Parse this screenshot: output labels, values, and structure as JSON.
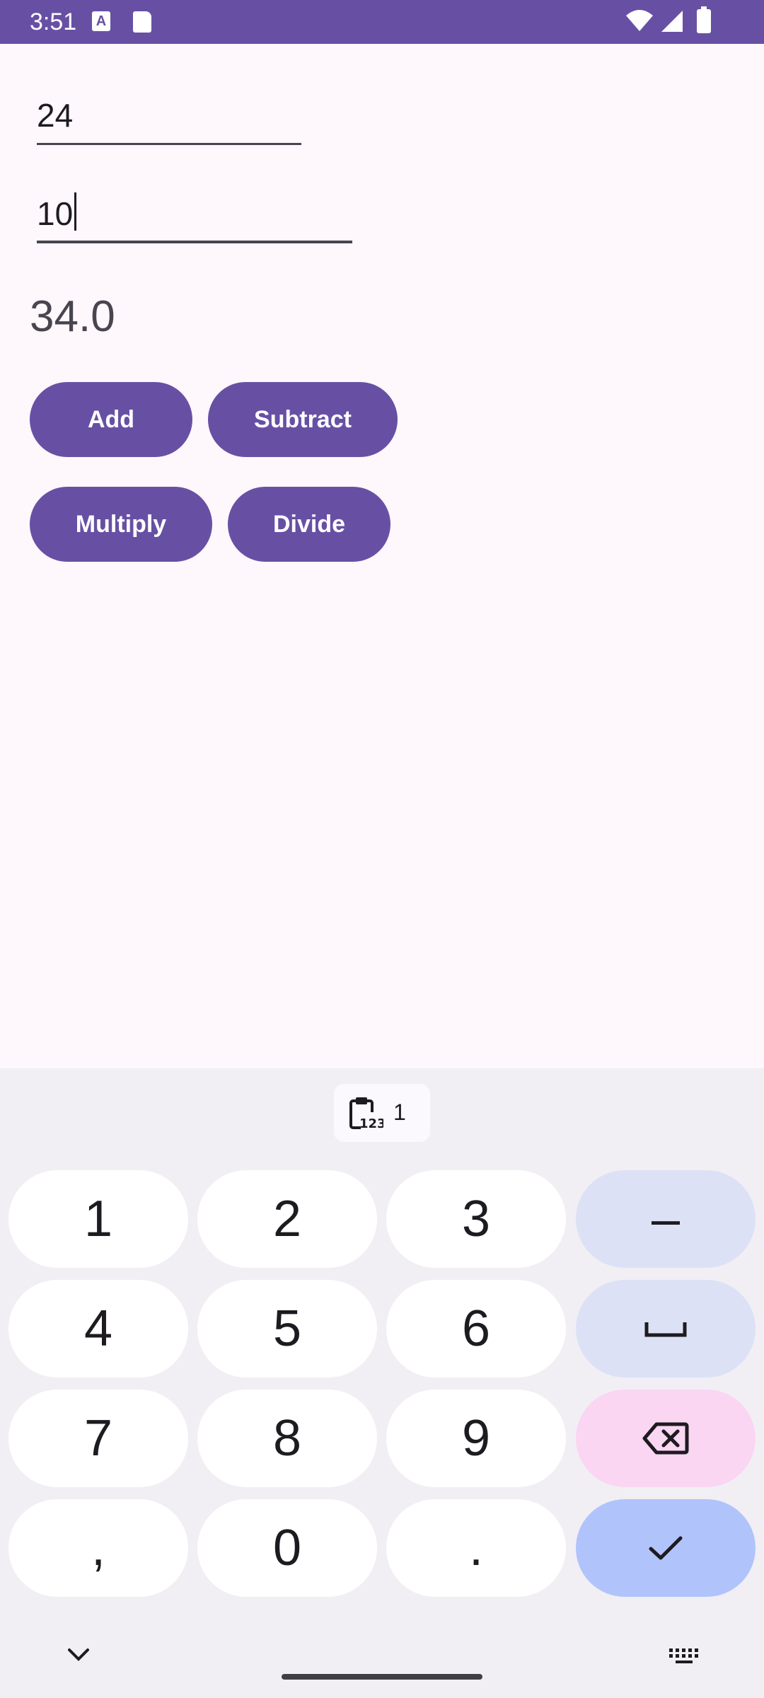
{
  "status_bar": {
    "time": "3:51",
    "icons": [
      "app-notification-icon",
      "sd-card-icon",
      "wifi-icon",
      "signal-icon",
      "battery-icon"
    ],
    "a_glyph": "A"
  },
  "form": {
    "first_number": "24",
    "second_number": "10",
    "result": "34.0"
  },
  "buttons": {
    "add": "Add",
    "subtract": "Subtract",
    "multiply": "Multiply",
    "divide": "Divide"
  },
  "keyboard": {
    "clipboard_count": "1",
    "keys": {
      "k1": "1",
      "k2": "2",
      "k3": "3",
      "minus": "–",
      "k4": "4",
      "k5": "5",
      "k6": "6",
      "k7": "7",
      "k8": "8",
      "k9": "9",
      "comma": ",",
      "k0": "0",
      "period": "."
    }
  },
  "colors": {
    "primary": "#6750a4",
    "background": "#fef7fc",
    "keyboard_bg": "#f1eff4",
    "function_key": "#dde1f6",
    "delete_key": "#fad6f3",
    "enter_key": "#b0c4fb"
  }
}
